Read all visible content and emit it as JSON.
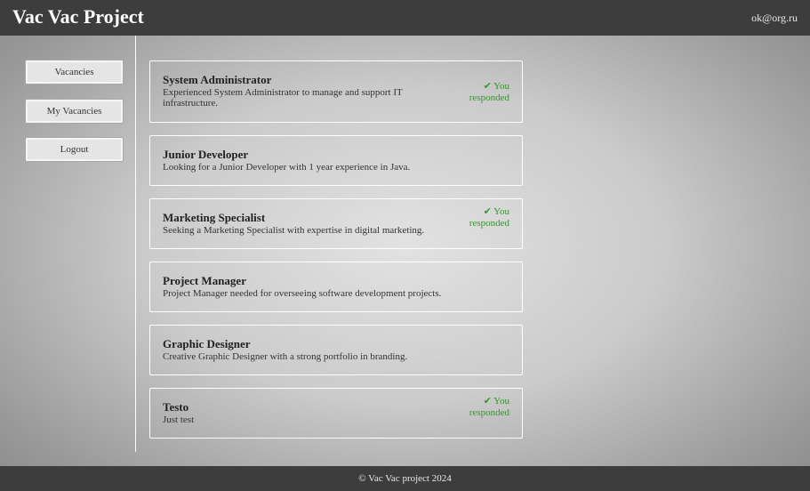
{
  "header": {
    "title": "Vac Vac Project",
    "user_email": "ok@org.ru"
  },
  "sidebar": {
    "items": [
      {
        "label": "Vacancies"
      },
      {
        "label": "My Vacancies"
      },
      {
        "label": "Logout"
      }
    ]
  },
  "vacancies": [
    {
      "title": "System Administrator",
      "description": "Experienced System Administrator to manage and support IT infrastructure.",
      "status": "✔ You responded"
    },
    {
      "title": "Junior Developer",
      "description": "Looking for a Junior Developer with 1 year experience in Java.",
      "status": ""
    },
    {
      "title": "Marketing Specialist",
      "description": "Seeking a Marketing Specialist with expertise in digital marketing.",
      "status": "✔ You responded"
    },
    {
      "title": "Project Manager",
      "description": "Project Manager needed for overseeing software development projects.",
      "status": ""
    },
    {
      "title": "Graphic Designer",
      "description": "Creative Graphic Designer with a strong portfolio in branding.",
      "status": ""
    },
    {
      "title": "Testo",
      "description": "Just test",
      "status": "✔ You responded"
    }
  ],
  "footer": {
    "text": "© Vac Vac project 2024"
  },
  "colors": {
    "header_bg": "#3d3d3d",
    "responded": "#2f9a24"
  }
}
